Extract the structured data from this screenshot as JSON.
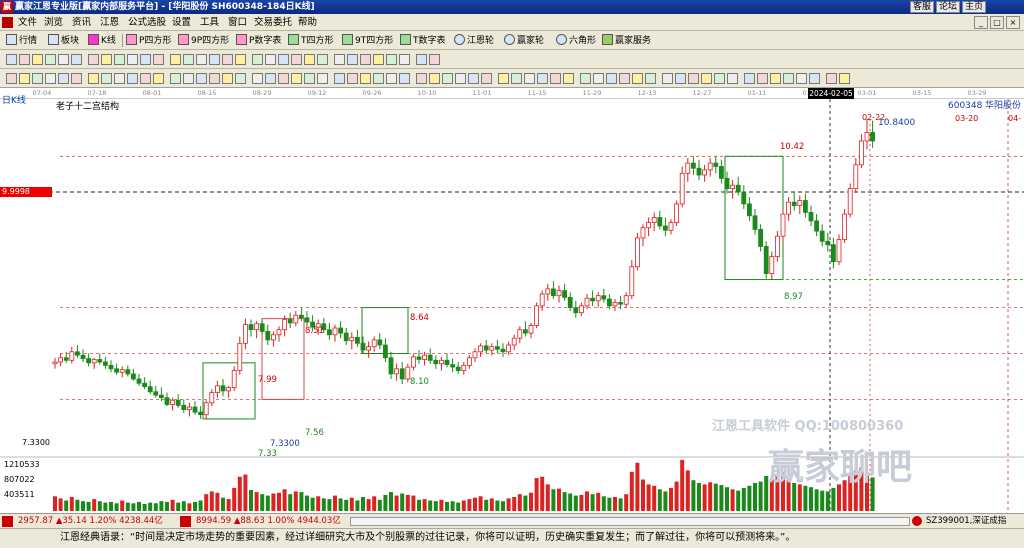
{
  "window": {
    "app_logo": "赢",
    "title": "赢家江恩专业版[赢家内部服务平台] - [华阳股份  SH600348-184日K线]",
    "links": [
      "客服",
      "论坛",
      "主页"
    ]
  },
  "menu": [
    "文件",
    "浏览",
    "资讯",
    "江恩",
    "公式选股",
    "设置",
    "工具",
    "窗口",
    "交易委托",
    "帮助"
  ],
  "window_controls": [
    "_",
    "□",
    "×"
  ],
  "toolbar": [
    "行情",
    "板块",
    "K线",
    "P四方形",
    "9P四方形",
    "P数字表",
    "T四方形",
    "9T四方形",
    "T数字表",
    "江恩轮",
    "赢家轮",
    "六角形",
    "赢家服务"
  ],
  "chart": {
    "period_label": "日K线",
    "study_label": "老子十二宫结构",
    "stock_code": "600348",
    "stock_name": "华阳股份",
    "current_date": "2024-02-05",
    "last_price": "10.8400",
    "last_price_date": "02-22",
    "next_date": "03-20",
    "next_month": "04-",
    "hline_price": "9.9998",
    "low_label": "7.3300",
    "low_price": "7.3300",
    "box_labels": [
      "7.33",
      "7.99",
      "7.56",
      "8.51",
      "8.64",
      "8.10",
      "10.42",
      "8.97"
    ],
    "volume_ticks": [
      "1210533",
      "807022",
      "403511"
    ],
    "watermark1": "江恩工具软件 QQ:100800360",
    "watermark2": "赢家聊吧",
    "date_ticks": [
      "07-04",
      "07-18",
      "08-01",
      "08-15",
      "08-29",
      "09-12",
      "09-26",
      "10-10",
      "11-01",
      "11-15",
      "11-29",
      "12-13",
      "12-27",
      "01-11",
      "01-25",
      "03-01",
      "03-15",
      "03-29"
    ]
  },
  "index_bar": {
    "sh": {
      "value": "2957.87",
      "change": "▲35.14",
      "pct": "1.20%",
      "amount": "4238.44亿"
    },
    "sz": {
      "value": "8994.59",
      "change": "▲88.63",
      "pct": "1.00%",
      "amount": "4944.03亿"
    },
    "right": "SZ399001,深证成指"
  },
  "quote": "江恩经典语录：“时间是决定市场走势的重要因素，经过详细研究大市及个别股票的过往记录，你将可以证明，历史确实重复发生；而了解过往，你将可以预测将来。”。",
  "chart_data": {
    "type": "candlestick",
    "ohlc": [
      [
        7.98,
        8.05,
        7.92,
        8.0
      ],
      [
        8.0,
        8.1,
        7.95,
        8.05
      ],
      [
        8.05,
        8.12,
        7.99,
        8.02
      ],
      [
        8.02,
        8.18,
        7.98,
        8.12
      ],
      [
        8.12,
        8.2,
        8.05,
        8.08
      ],
      [
        8.08,
        8.15,
        8.0,
        8.04
      ],
      [
        8.04,
        8.1,
        7.95,
        7.99
      ],
      [
        7.99,
        8.05,
        7.92,
        8.03
      ],
      [
        8.03,
        8.1,
        7.97,
        8.0
      ],
      [
        8.0,
        8.06,
        7.92,
        7.96
      ],
      [
        7.96,
        8.02,
        7.88,
        7.92
      ],
      [
        7.92,
        7.98,
        7.85,
        7.88
      ],
      [
        7.88,
        7.95,
        7.82,
        7.91
      ],
      [
        7.91,
        7.96,
        7.83,
        7.86
      ],
      [
        7.86,
        7.92,
        7.78,
        7.8
      ],
      [
        7.8,
        7.86,
        7.72,
        7.75
      ],
      [
        7.75,
        7.82,
        7.68,
        7.71
      ],
      [
        7.71,
        7.78,
        7.62,
        7.65
      ],
      [
        7.65,
        7.72,
        7.58,
        7.61
      ],
      [
        7.61,
        7.7,
        7.54,
        7.58
      ],
      [
        7.58,
        7.64,
        7.48,
        7.5
      ],
      [
        7.5,
        7.58,
        7.43,
        7.55
      ],
      [
        7.55,
        7.62,
        7.46,
        7.49
      ],
      [
        7.49,
        7.56,
        7.4,
        7.44
      ],
      [
        7.44,
        7.52,
        7.36,
        7.47
      ],
      [
        7.47,
        7.54,
        7.38,
        7.41
      ],
      [
        7.41,
        7.48,
        7.33,
        7.38
      ],
      [
        7.38,
        7.55,
        7.33,
        7.52
      ],
      [
        7.52,
        7.68,
        7.48,
        7.64
      ],
      [
        7.64,
        7.78,
        7.58,
        7.72
      ],
      [
        7.72,
        7.8,
        7.6,
        7.66
      ],
      [
        7.66,
        7.72,
        7.58,
        7.7
      ],
      [
        7.7,
        7.95,
        7.66,
        7.9
      ],
      [
        7.9,
        8.3,
        7.85,
        8.22
      ],
      [
        8.22,
        8.51,
        8.15,
        8.44
      ],
      [
        8.44,
        8.5,
        8.3,
        8.38
      ],
      [
        8.38,
        8.48,
        8.28,
        8.45
      ],
      [
        8.45,
        8.5,
        8.32,
        8.36
      ],
      [
        8.36,
        8.44,
        8.2,
        8.26
      ],
      [
        8.26,
        8.36,
        8.18,
        8.32
      ],
      [
        8.32,
        8.42,
        8.24,
        8.38
      ],
      [
        8.38,
        8.55,
        8.3,
        8.5
      ],
      [
        8.5,
        8.58,
        8.4,
        8.46
      ],
      [
        8.46,
        8.6,
        8.42,
        8.55
      ],
      [
        8.55,
        8.64,
        8.48,
        8.52
      ],
      [
        8.52,
        8.6,
        8.42,
        8.47
      ],
      [
        8.47,
        8.55,
        8.36,
        8.41
      ],
      [
        8.41,
        8.5,
        8.32,
        8.45
      ],
      [
        8.45,
        8.52,
        8.34,
        8.38
      ],
      [
        8.38,
        8.46,
        8.26,
        8.32
      ],
      [
        8.32,
        8.44,
        8.24,
        8.4
      ],
      [
        8.4,
        8.48,
        8.28,
        8.34
      ],
      [
        8.34,
        8.4,
        8.2,
        8.25
      ],
      [
        8.25,
        8.35,
        8.15,
        8.29
      ],
      [
        8.29,
        8.38,
        8.18,
        8.22
      ],
      [
        8.22,
        8.3,
        8.1,
        8.14
      ],
      [
        8.14,
        8.24,
        8.05,
        8.18
      ],
      [
        8.18,
        8.3,
        8.12,
        8.26
      ],
      [
        8.26,
        8.34,
        8.15,
        8.2
      ],
      [
        8.2,
        8.28,
        8.0,
        8.05
      ],
      [
        8.05,
        8.12,
        7.8,
        7.86
      ],
      [
        7.86,
        7.98,
        7.78,
        7.92
      ],
      [
        7.92,
        8.0,
        7.74,
        7.8
      ],
      [
        7.8,
        7.98,
        7.76,
        7.94
      ],
      [
        7.94,
        8.1,
        7.9,
        8.06
      ],
      [
        8.06,
        8.14,
        7.98,
        8.03
      ],
      [
        8.03,
        8.12,
        7.96,
        8.08
      ],
      [
        8.08,
        8.16,
        7.98,
        8.02
      ],
      [
        8.02,
        8.08,
        7.92,
        7.98
      ],
      [
        7.98,
        8.06,
        7.9,
        8.02
      ],
      [
        8.02,
        8.1,
        7.94,
        7.97
      ],
      [
        7.97,
        8.04,
        7.88,
        7.94
      ],
      [
        7.94,
        8.0,
        7.86,
        7.9
      ],
      [
        7.9,
        8.0,
        7.85,
        7.96
      ],
      [
        7.96,
        8.08,
        7.92,
        8.05
      ],
      [
        8.05,
        8.16,
        8.0,
        8.12
      ],
      [
        8.12,
        8.22,
        8.06,
        8.19
      ],
      [
        8.19,
        8.26,
        8.1,
        8.14
      ],
      [
        8.14,
        8.22,
        8.08,
        8.18
      ],
      [
        8.18,
        8.26,
        8.1,
        8.15
      ],
      [
        8.15,
        8.22,
        8.06,
        8.12
      ],
      [
        8.12,
        8.24,
        8.08,
        8.2
      ],
      [
        8.2,
        8.32,
        8.14,
        8.28
      ],
      [
        8.28,
        8.42,
        8.22,
        8.38
      ],
      [
        8.38,
        8.48,
        8.3,
        8.34
      ],
      [
        8.34,
        8.46,
        8.28,
        8.43
      ],
      [
        8.43,
        8.7,
        8.4,
        8.66
      ],
      [
        8.66,
        8.84,
        8.6,
        8.8
      ],
      [
        8.8,
        8.92,
        8.72,
        8.86
      ],
      [
        8.86,
        8.95,
        8.74,
        8.78
      ],
      [
        8.78,
        8.9,
        8.7,
        8.84
      ],
      [
        8.84,
        8.92,
        8.72,
        8.76
      ],
      [
        8.76,
        8.82,
        8.6,
        8.64
      ],
      [
        8.64,
        8.72,
        8.52,
        8.58
      ],
      [
        8.58,
        8.7,
        8.54,
        8.66
      ],
      [
        8.66,
        8.8,
        8.62,
        8.75
      ],
      [
        8.75,
        8.84,
        8.66,
        8.72
      ],
      [
        8.72,
        8.82,
        8.64,
        8.78
      ],
      [
        8.78,
        8.86,
        8.7,
        8.74
      ],
      [
        8.74,
        8.8,
        8.62,
        8.66
      ],
      [
        8.66,
        8.74,
        8.6,
        8.7
      ],
      [
        8.7,
        8.78,
        8.62,
        8.68
      ],
      [
        8.68,
        8.82,
        8.64,
        8.78
      ],
      [
        8.78,
        9.2,
        8.74,
        9.12
      ],
      [
        9.12,
        9.52,
        9.08,
        9.46
      ],
      [
        9.46,
        9.62,
        9.36,
        9.58
      ],
      [
        9.58,
        9.7,
        9.48,
        9.64
      ],
      [
        9.64,
        9.76,
        9.54,
        9.7
      ],
      [
        9.7,
        9.78,
        9.56,
        9.6
      ],
      [
        9.6,
        9.7,
        9.48,
        9.55
      ],
      [
        9.55,
        9.68,
        9.5,
        9.64
      ],
      [
        9.64,
        9.9,
        9.6,
        9.86
      ],
      [
        9.86,
        10.3,
        9.82,
        10.22
      ],
      [
        10.22,
        10.4,
        10.12,
        10.34
      ],
      [
        10.34,
        10.42,
        10.2,
        10.28
      ],
      [
        10.28,
        10.38,
        10.14,
        10.2
      ],
      [
        10.2,
        10.32,
        10.12,
        10.26
      ],
      [
        10.26,
        10.4,
        10.18,
        10.34
      ],
      [
        10.34,
        10.42,
        10.22,
        10.3
      ],
      [
        10.3,
        10.38,
        10.1,
        10.16
      ],
      [
        10.16,
        10.24,
        9.98,
        10.04
      ],
      [
        10.04,
        10.14,
        9.92,
        10.08
      ],
      [
        10.08,
        10.18,
        9.96,
        10.0
      ],
      [
        10.0,
        10.08,
        9.8,
        9.86
      ],
      [
        9.86,
        9.94,
        9.66,
        9.72
      ],
      [
        9.72,
        9.8,
        9.5,
        9.56
      ],
      [
        9.56,
        9.62,
        9.3,
        9.36
      ],
      [
        9.36,
        9.42,
        8.98,
        9.04
      ],
      [
        9.04,
        9.3,
        8.97,
        9.24
      ],
      [
        9.24,
        9.54,
        9.18,
        9.48
      ],
      [
        9.48,
        9.8,
        9.42,
        9.74
      ],
      [
        9.74,
        9.94,
        9.66,
        9.88
      ],
      [
        9.88,
        10.0,
        9.78,
        9.84
      ],
      [
        9.84,
        9.96,
        9.74,
        9.9
      ],
      [
        9.9,
        9.98,
        9.7,
        9.76
      ],
      [
        9.76,
        9.84,
        9.6,
        9.66
      ],
      [
        9.66,
        9.74,
        9.48,
        9.54
      ],
      [
        9.54,
        9.62,
        9.36,
        9.42
      ],
      [
        9.42,
        9.52,
        9.3,
        9.38
      ],
      [
        9.38,
        9.46,
        9.1,
        9.18
      ],
      [
        9.18,
        9.5,
        9.14,
        9.44
      ],
      [
        9.44,
        9.8,
        9.4,
        9.74
      ],
      [
        9.74,
        10.1,
        9.7,
        10.04
      ],
      [
        10.04,
        10.4,
        10.0,
        10.32
      ],
      [
        10.32,
        10.68,
        10.28,
        10.6
      ],
      [
        10.6,
        10.86,
        10.5,
        10.7
      ],
      [
        10.7,
        10.84,
        10.52,
        10.6
      ]
    ],
    "volume": [
      0.21,
      0.18,
      0.15,
      0.2,
      0.16,
      0.14,
      0.13,
      0.17,
      0.14,
      0.12,
      0.13,
      0.11,
      0.15,
      0.12,
      0.11,
      0.13,
      0.1,
      0.12,
      0.11,
      0.14,
      0.13,
      0.16,
      0.12,
      0.14,
      0.11,
      0.13,
      0.15,
      0.24,
      0.28,
      0.26,
      0.19,
      0.17,
      0.33,
      0.49,
      0.52,
      0.3,
      0.27,
      0.24,
      0.22,
      0.25,
      0.26,
      0.31,
      0.24,
      0.28,
      0.27,
      0.22,
      0.19,
      0.21,
      0.18,
      0.17,
      0.22,
      0.18,
      0.16,
      0.19,
      0.15,
      0.2,
      0.17,
      0.21,
      0.16,
      0.23,
      0.27,
      0.22,
      0.25,
      0.23,
      0.22,
      0.16,
      0.17,
      0.15,
      0.14,
      0.16,
      0.13,
      0.14,
      0.12,
      0.15,
      0.17,
      0.19,
      0.21,
      0.16,
      0.18,
      0.15,
      0.14,
      0.18,
      0.2,
      0.24,
      0.22,
      0.26,
      0.47,
      0.49,
      0.38,
      0.31,
      0.32,
      0.27,
      0.25,
      0.22,
      0.23,
      0.28,
      0.24,
      0.26,
      0.21,
      0.19,
      0.2,
      0.18,
      0.24,
      0.56,
      0.69,
      0.45,
      0.38,
      0.36,
      0.31,
      0.28,
      0.33,
      0.42,
      0.73,
      0.58,
      0.44,
      0.4,
      0.38,
      0.41,
      0.39,
      0.37,
      0.34,
      0.31,
      0.29,
      0.33,
      0.36,
      0.4,
      0.42,
      0.5,
      0.46,
      0.52,
      0.55,
      0.47,
      0.4,
      0.38,
      0.36,
      0.34,
      0.31,
      0.29,
      0.28,
      0.33,
      0.38,
      0.44,
      0.52,
      0.58,
      0.62,
      0.55,
      0.48
    ],
    "y_range": [
      7.1,
      11.0
    ],
    "volume_range": [
      0,
      1613000
    ]
  }
}
